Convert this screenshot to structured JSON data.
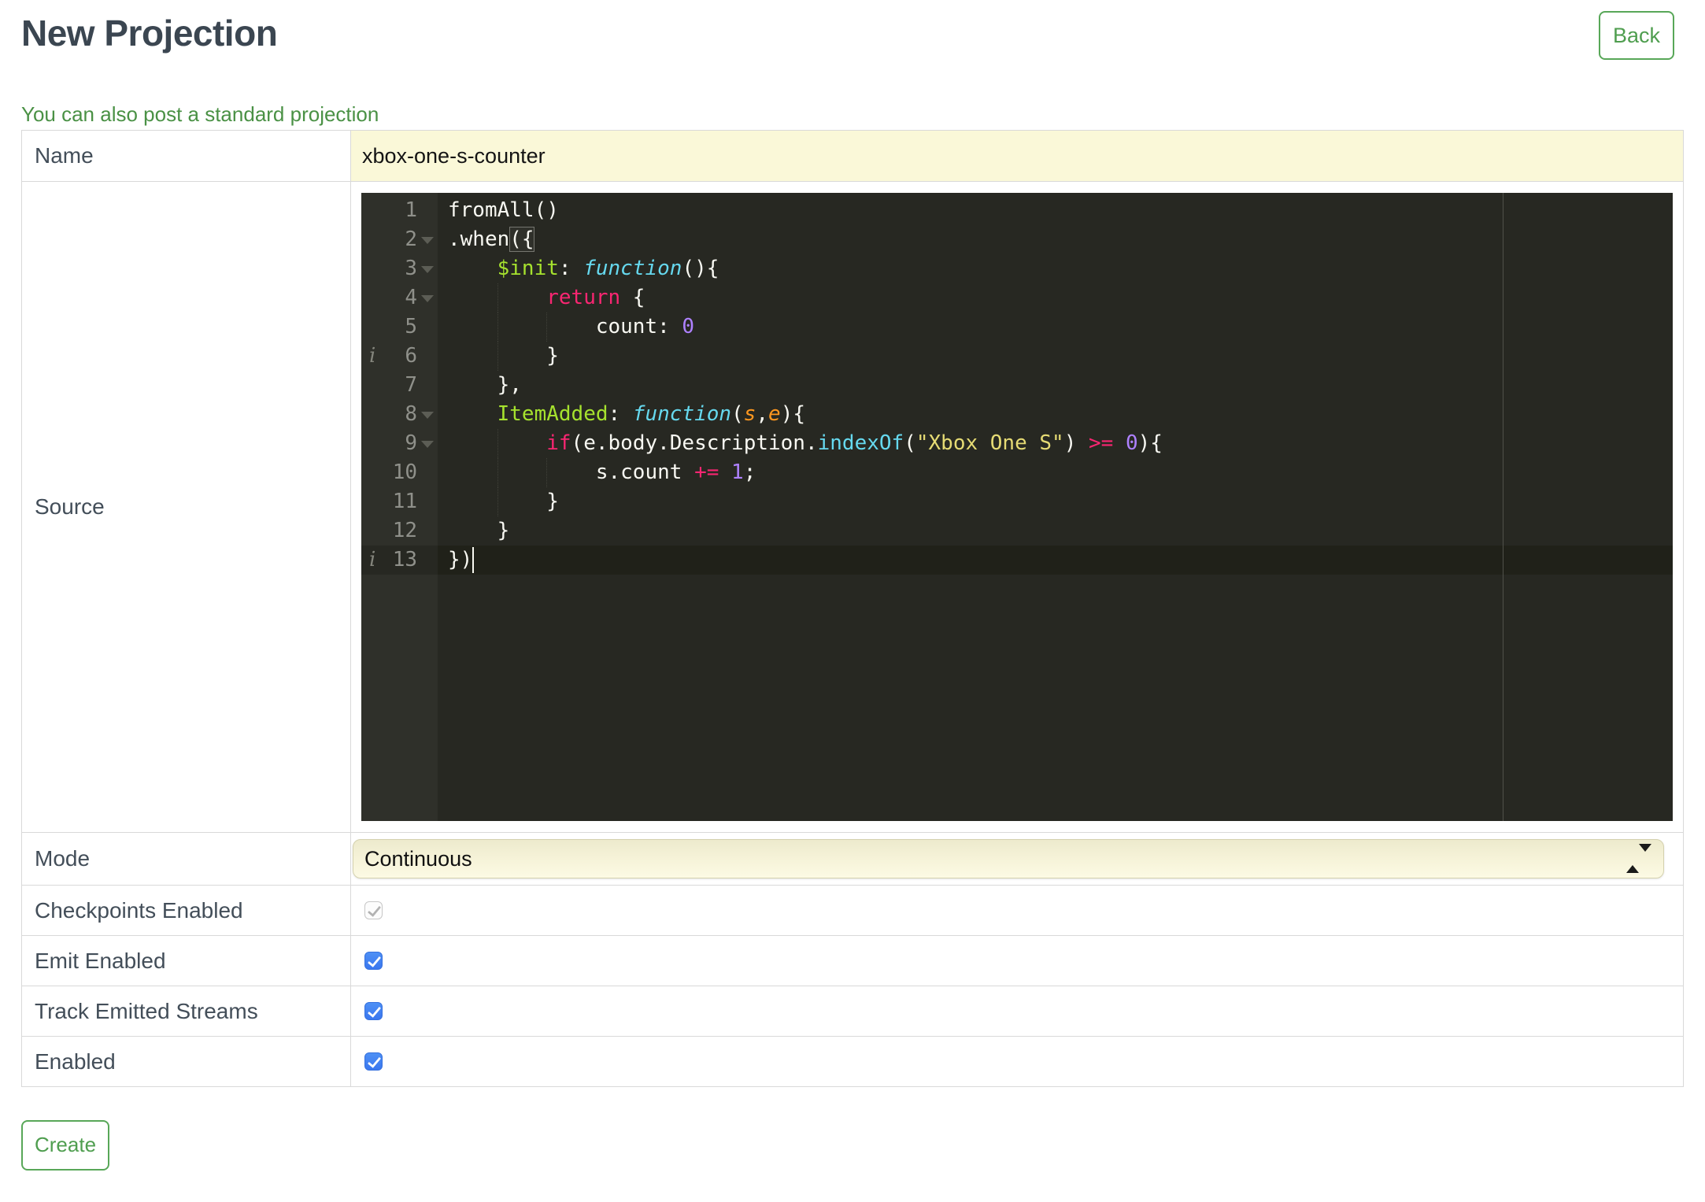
{
  "page": {
    "title": "New Projection",
    "back_label": "Back",
    "standard_link": "You can also post a standard projection",
    "create_label": "Create"
  },
  "form": {
    "name": {
      "label": "Name",
      "value": "xbox-one-s-counter"
    },
    "source": {
      "label": "Source"
    },
    "mode": {
      "label": "Mode",
      "value": "Continuous"
    },
    "checkpoints": {
      "label": "Checkpoints Enabled",
      "checked": true,
      "disabled": true
    },
    "emit": {
      "label": "Emit Enabled",
      "checked": true,
      "disabled": false
    },
    "track": {
      "label": "Track Emitted Streams",
      "checked": true,
      "disabled": false
    },
    "enabled": {
      "label": "Enabled",
      "checked": true,
      "disabled": false
    }
  },
  "editor": {
    "language": "javascript",
    "code": "fromAll()\n.when({\n    $init: function(){\n        return {\n            count: 0\n        }\n    },\n    ItemAdded: function(s,e){\n        if(e.body.Description.indexOf(\"Xbox One S\") >= 0){\n            s.count += 1;\n        }\n    }\n})",
    "active_line": 13,
    "cursor": {
      "line": 13,
      "col": 2
    },
    "bracket_highlight": {
      "line": 2,
      "col": 5,
      "len": 2
    },
    "gutter": {
      "fold_lines": [
        2,
        3,
        4,
        8,
        9
      ],
      "info_lines": [
        6,
        13
      ]
    },
    "lines": [
      [
        {
          "t": "fromAll()",
          "c": "plain"
        }
      ],
      [
        {
          "t": ".when({",
          "c": "plain"
        }
      ],
      [
        {
          "t": "    ",
          "c": "plain"
        },
        {
          "t": "$init",
          "c": "entity"
        },
        {
          "t": ": ",
          "c": "plain"
        },
        {
          "t": "function",
          "c": "kwfunc"
        },
        {
          "t": "(){",
          "c": "plain"
        }
      ],
      [
        {
          "t": "        ",
          "c": "plain"
        },
        {
          "t": "return",
          "c": "keyword"
        },
        {
          "t": " {",
          "c": "plain"
        }
      ],
      [
        {
          "t": "            count: ",
          "c": "plain"
        },
        {
          "t": "0",
          "c": "number"
        }
      ],
      [
        {
          "t": "        }",
          "c": "plain"
        }
      ],
      [
        {
          "t": "    },",
          "c": "plain"
        }
      ],
      [
        {
          "t": "    ",
          "c": "plain"
        },
        {
          "t": "ItemAdded",
          "c": "entity"
        },
        {
          "t": ": ",
          "c": "plain"
        },
        {
          "t": "function",
          "c": "kwfunc"
        },
        {
          "t": "(",
          "c": "plain"
        },
        {
          "t": "s",
          "c": "param"
        },
        {
          "t": ",",
          "c": "plain"
        },
        {
          "t": "e",
          "c": "param"
        },
        {
          "t": "){",
          "c": "plain"
        }
      ],
      [
        {
          "t": "        ",
          "c": "plain"
        },
        {
          "t": "if",
          "c": "keyword"
        },
        {
          "t": "(e.body.Description.",
          "c": "plain"
        },
        {
          "t": "indexOf",
          "c": "support"
        },
        {
          "t": "(",
          "c": "plain"
        },
        {
          "t": "\"Xbox One S\"",
          "c": "string"
        },
        {
          "t": ") ",
          "c": "plain"
        },
        {
          "t": ">=",
          "c": "keyword"
        },
        {
          "t": " ",
          "c": "plain"
        },
        {
          "t": "0",
          "c": "number"
        },
        {
          "t": "){",
          "c": "plain"
        }
      ],
      [
        {
          "t": "            s.count ",
          "c": "plain"
        },
        {
          "t": "+=",
          "c": "keyword"
        },
        {
          "t": " ",
          "c": "plain"
        },
        {
          "t": "1",
          "c": "number"
        },
        {
          "t": ";",
          "c": "plain"
        }
      ],
      [
        {
          "t": "        }",
          "c": "plain"
        }
      ],
      [
        {
          "t": "    }",
          "c": "plain"
        }
      ],
      [
        {
          "t": "})",
          "c": "plain"
        }
      ]
    ]
  },
  "colors": {
    "accent_green": "#4f9e4f",
    "link_green": "#4a9145",
    "label_text": "#434e59",
    "input_yellow": "#faf8d8",
    "checkbox_blue": "#3f7df1",
    "editor_background": "#272822",
    "editor_gutter": "#2f302a",
    "editor_plain_text": "#f8f8f2",
    "syntax_keyword": "#f92672",
    "syntax_entity": "#a6e22e",
    "syntax_function": "#66d9ef",
    "syntax_param": "#fd971f",
    "syntax_string": "#e6db74",
    "syntax_number": "#ae81ff"
  }
}
